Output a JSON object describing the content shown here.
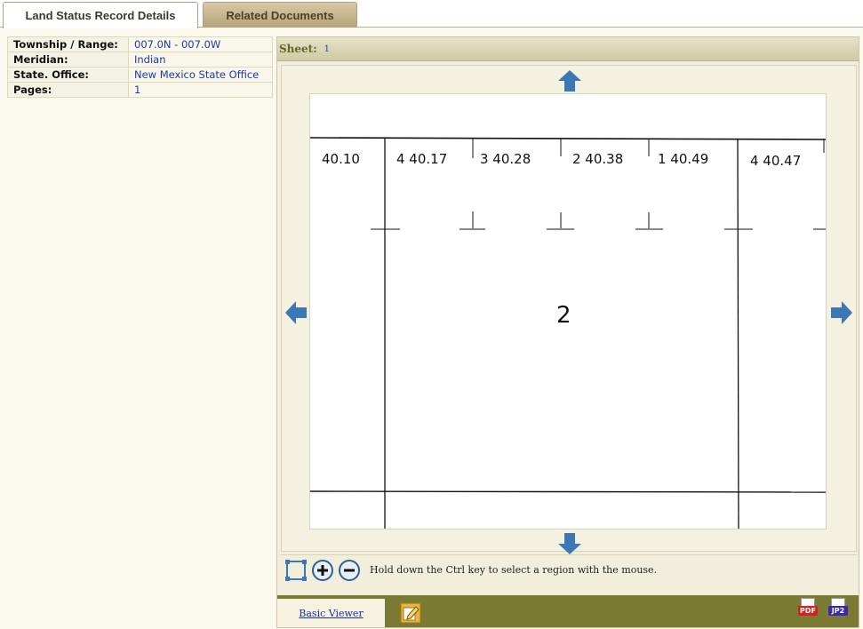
{
  "tabs": [
    {
      "label": "Land Status Record Details"
    },
    {
      "label": "Related Documents"
    }
  ],
  "details": [
    {
      "key": "Township / Range:",
      "value": "007.0N - 007.0W"
    },
    {
      "key": "Meridian:",
      "value": "Indian"
    },
    {
      "key": "State. Office:",
      "value": "New Mexico State Office"
    },
    {
      "key": "Pages:",
      "value": "1"
    }
  ],
  "viewer": {
    "sheet_label": "Sheet:",
    "sheet_value": "1",
    "hint": "Hold down the Ctrl key to select a region with the mouse.",
    "basic_viewer": "Basic Viewer",
    "pdf_label": "PDF",
    "jp2_label": "JP2"
  },
  "document": {
    "lot_labels": [
      "40.10",
      "4 40.17",
      "3 40.28",
      "2 40.38",
      "1 40.49",
      "4 40.47"
    ],
    "section_number": "2"
  },
  "colors": {
    "arrow": "#3d78b6",
    "link": "#1f3aa8",
    "footer": "#7b7a35"
  },
  "icons": [
    "arrow-up-icon",
    "arrow-down-icon",
    "arrow-left-icon",
    "arrow-right-icon",
    "select-region-icon",
    "zoom-in-icon",
    "zoom-out-icon",
    "edit-icon",
    "pdf-icon",
    "jp2-icon"
  ]
}
